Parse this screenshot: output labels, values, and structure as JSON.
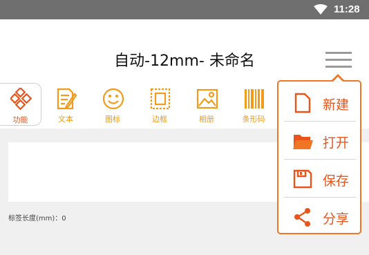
{
  "status_bar": {
    "time": "11:28",
    "icons": [
      "wifi-icon"
    ]
  },
  "header": {
    "title": "自动-12mm- 未命名",
    "menu_icon": "hamburger-menu-icon"
  },
  "toolbar": {
    "items": [
      {
        "label": "功能",
        "icon": "function-grid-icon",
        "active": true
      },
      {
        "label": "文本",
        "icon": "text-edit-icon"
      },
      {
        "label": "图标",
        "icon": "smiley-icon"
      },
      {
        "label": "边框",
        "icon": "border-frame-icon"
      },
      {
        "label": "相册",
        "icon": "photo-album-icon"
      },
      {
        "label": "条形码",
        "icon": "barcode-icon"
      }
    ]
  },
  "label_length": "标签长度(mm)：0",
  "dropdown_menu": {
    "items": [
      {
        "label": "新建",
        "icon": "new-file-icon"
      },
      {
        "label": "打开",
        "icon": "open-folder-icon"
      },
      {
        "label": "保存",
        "icon": "save-icon"
      },
      {
        "label": "分享",
        "icon": "share-icon"
      }
    ]
  },
  "colors": {
    "accent": "#f07525",
    "toolbar_icon": "#f29a1b",
    "status_bar": "#6f6f6f"
  }
}
